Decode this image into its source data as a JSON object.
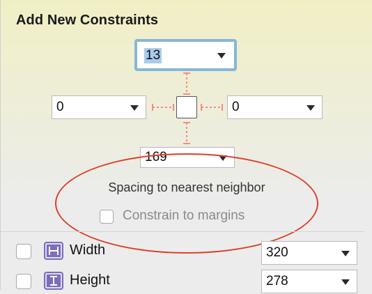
{
  "panel": {
    "title": "Add New Constraints"
  },
  "spacing": {
    "top_value": "13",
    "left_value": "0",
    "right_value": "0",
    "bottom_value": "169",
    "label": "Spacing to nearest neighbor"
  },
  "margins": {
    "label": "Constrain to margins",
    "checked": false
  },
  "dimensions": {
    "width": {
      "label": "Width",
      "value": "320",
      "checked": false,
      "icon": "width-h-icon"
    },
    "height": {
      "label": "Height",
      "value": "278",
      "checked": false,
      "icon": "height-i-icon"
    }
  },
  "colors": {
    "strut": "#f0907c",
    "annotation": "#e03e28",
    "focus_ring": "#86b6d8",
    "icon_bg": "#7d6dbd"
  }
}
